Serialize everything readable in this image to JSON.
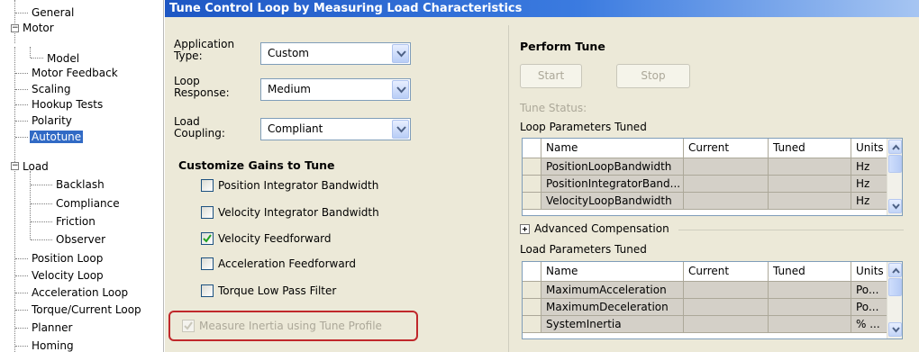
{
  "tree": {
    "items": [
      {
        "label": "General"
      },
      {
        "label": "Motor"
      },
      {
        "label": "Model"
      },
      {
        "label": "Motor Feedback"
      },
      {
        "label": "Scaling"
      },
      {
        "label": "Hookup Tests"
      },
      {
        "label": "Polarity"
      },
      {
        "label": "Autotune"
      },
      {
        "label": "Load"
      },
      {
        "label": "Backlash"
      },
      {
        "label": "Compliance"
      },
      {
        "label": "Friction"
      },
      {
        "label": "Observer"
      },
      {
        "label": "Position Loop"
      },
      {
        "label": "Velocity Loop"
      },
      {
        "label": "Acceleration Loop"
      },
      {
        "label": "Torque/Current Loop"
      },
      {
        "label": "Planner"
      },
      {
        "label": "Homing"
      }
    ],
    "selected": "Autotune"
  },
  "panel": {
    "title": "Tune Control Loop by Measuring Load Characteristics"
  },
  "settings": {
    "application_type_label": "Application Type:",
    "application_type_label_l1": "Application",
    "application_type_label_l2": "Type:",
    "application_type_value": "Custom",
    "loop_response_label_l1": "Loop",
    "loop_response_label_l2": "Response:",
    "loop_response_value": "Medium",
    "load_coupling_label_l1": "Load",
    "load_coupling_label_l2": "Coupling:",
    "load_coupling_value": "Compliant"
  },
  "gains": {
    "title": "Customize Gains to Tune",
    "items": [
      {
        "label": "Position Integrator Bandwidth",
        "checked": false
      },
      {
        "label": "Velocity Integrator Bandwidth",
        "checked": false
      },
      {
        "label": "Velocity Feedforward",
        "checked": true
      },
      {
        "label": "Acceleration Feedforward",
        "checked": false
      },
      {
        "label": "Torque Low Pass Filter",
        "checked": false
      }
    ],
    "measure_inertia_label": "Measure Inertia using Tune Profile",
    "measure_inertia_checked": true,
    "measure_inertia_enabled": false
  },
  "perform_tune": {
    "title": "Perform Tune",
    "start_label": "Start",
    "stop_label": "Stop",
    "tune_status_label": "Tune Status:"
  },
  "loop_params": {
    "title": "Loop Parameters Tuned",
    "columns": [
      "Name",
      "Current",
      "Tuned",
      "Units"
    ],
    "rows": [
      {
        "name": "PositionLoopBandwidth",
        "current": "",
        "tuned": "",
        "units": "Hz"
      },
      {
        "name": "PositionIntegratorBand...",
        "current": "",
        "tuned": "",
        "units": "Hz"
      },
      {
        "name": "VelocityLoopBandwidth",
        "current": "",
        "tuned": "",
        "units": "Hz"
      }
    ]
  },
  "advanced": {
    "label": "Advanced Compensation"
  },
  "load_params": {
    "title": "Load Parameters Tuned",
    "columns": [
      "Name",
      "Current",
      "Tuned",
      "Units"
    ],
    "rows": [
      {
        "name": "MaximumAcceleration",
        "current": "",
        "tuned": "",
        "units": "Po..."
      },
      {
        "name": "MaximumDeceleration",
        "current": "",
        "tuned": "",
        "units": "Po..."
      },
      {
        "name": "SystemInertia",
        "current": "",
        "tuned": "",
        "units": "% ..."
      }
    ]
  },
  "colors": {
    "title_bar": "#1e57c4",
    "panel_bg": "#ece9d8",
    "highlight_box": "#c0282b",
    "selected_bg": "#316ac5"
  }
}
